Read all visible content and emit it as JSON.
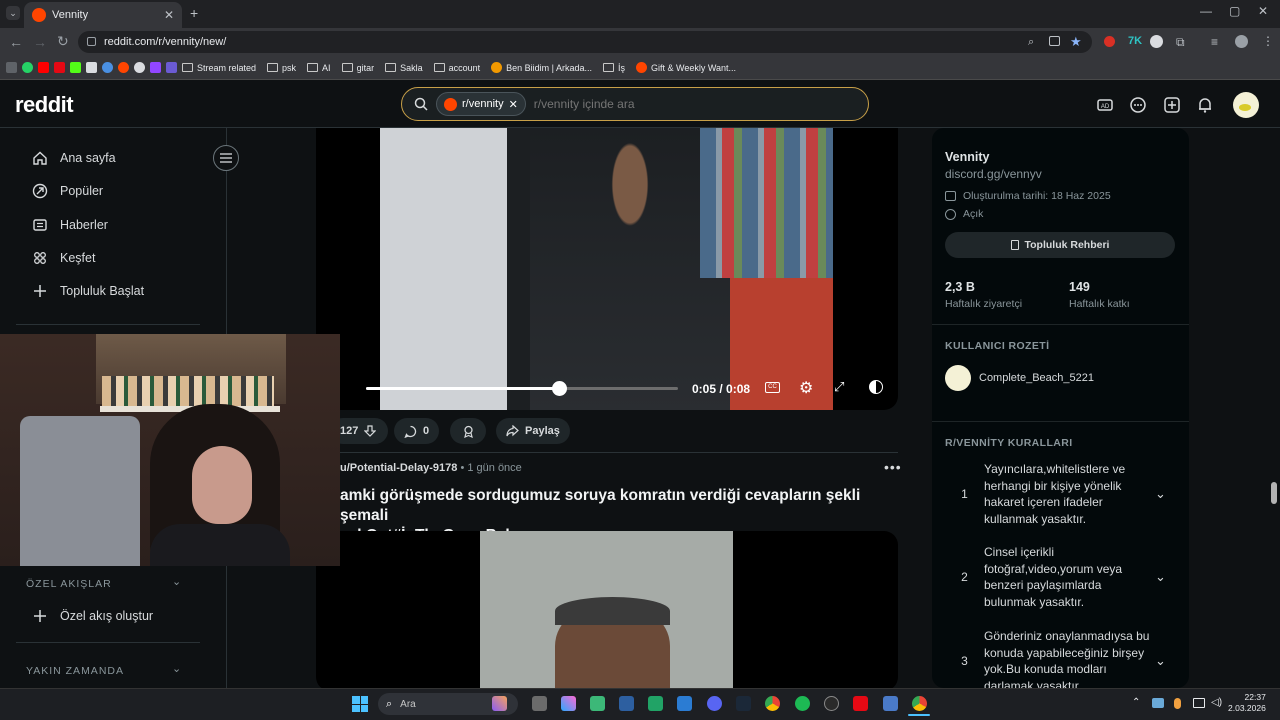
{
  "browser": {
    "tab_title": "Vennity",
    "url": "reddit.com/r/vennity/new/",
    "bookmarks": [
      "Stream related",
      "psk",
      "AI",
      "gitar",
      "Sakla",
      "account",
      "Ben Biidim | Arkada...",
      "İş",
      "Gift & Weekly Want..."
    ]
  },
  "header": {
    "logo": "reddit",
    "search_chip": "r/vennity",
    "search_placeholder": "r/vennity içinde ara"
  },
  "sidebar": {
    "items": [
      {
        "label": "Ana sayfa",
        "icon": "home-icon"
      },
      {
        "label": "Popüler",
        "icon": "popular-icon"
      },
      {
        "label": "Haberler",
        "icon": "news-icon"
      },
      {
        "label": "Keşfet",
        "icon": "explore-icon"
      },
      {
        "label": "Topluluk Başlat",
        "icon": "plus-icon"
      }
    ],
    "custom_feeds_header": "ÖZEL AKIŞLAR",
    "create_custom_feed": "Özel akış oluştur",
    "recent_header": "YAKIN ZAMANDA"
  },
  "post1": {
    "video_time": "0:05 / 0:08",
    "progress": 0.62,
    "votes": "127",
    "comments": "0",
    "share_label": "Paylaş"
  },
  "post2": {
    "author": "u/Potential-Delay-9178",
    "sep": "•",
    "time": "1 gün önce",
    "title_line1": "amki görüşmede sordugumuz soruya komratın verdiği cevapların şekli şemali",
    "title_line2": "ackOut#İnTheGameBaby"
  },
  "community": {
    "name": "Vennity",
    "link": "discord.gg/vennyv",
    "created": "Oluşturulma tarihi: 18 Haz 2025",
    "visibility": "Açık",
    "guide_button": "Topluluk Rehberi",
    "stat1_value": "2,3 B",
    "stat1_label": "Haftalık ziyaretçi",
    "stat2_value": "149",
    "stat2_label": "Haftalık katkı",
    "badge_header": "KULLANICI ROZETİ",
    "badge_user": "Complete_Beach_5221",
    "rules_header": "R/VENNİTY KURALLARI",
    "rules": [
      {
        "n": "1",
        "text": "Yayıncılara,whitelistlere ve herhangi bir kişiye yönelik hakaret içeren ifadeler kullanmak yasaktır."
      },
      {
        "n": "2",
        "text": "Cinsel içerikli fotoğraf,video,yorum veya benzeri paylaşımlarda bulunmak yasaktır."
      },
      {
        "n": "3",
        "text": "Gönderiniz onaylanmadıysa bu konuda yapabileceğiniz birşey yok.Bu konuda modları darlamak yasaktır."
      }
    ]
  },
  "taskbar": {
    "search": "Ara",
    "time": "22:37",
    "date": "2.03.2026"
  }
}
